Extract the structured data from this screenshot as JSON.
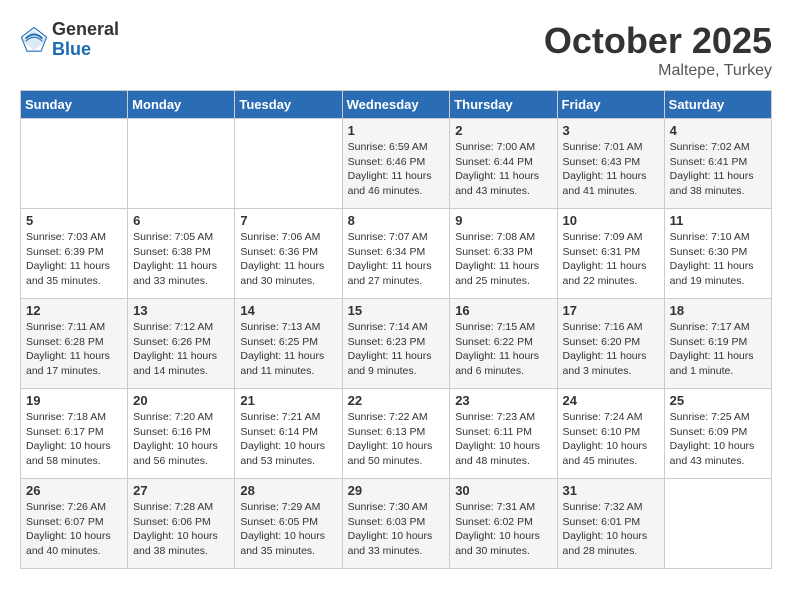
{
  "logo": {
    "general": "General",
    "blue": "Blue"
  },
  "title": "October 2025",
  "subtitle": "Maltepe, Turkey",
  "days_of_week": [
    "Sunday",
    "Monday",
    "Tuesday",
    "Wednesday",
    "Thursday",
    "Friday",
    "Saturday"
  ],
  "weeks": [
    [
      {
        "num": "",
        "info": ""
      },
      {
        "num": "",
        "info": ""
      },
      {
        "num": "",
        "info": ""
      },
      {
        "num": "1",
        "info": "Sunrise: 6:59 AM\nSunset: 6:46 PM\nDaylight: 11 hours\nand 46 minutes."
      },
      {
        "num": "2",
        "info": "Sunrise: 7:00 AM\nSunset: 6:44 PM\nDaylight: 11 hours\nand 43 minutes."
      },
      {
        "num": "3",
        "info": "Sunrise: 7:01 AM\nSunset: 6:43 PM\nDaylight: 11 hours\nand 41 minutes."
      },
      {
        "num": "4",
        "info": "Sunrise: 7:02 AM\nSunset: 6:41 PM\nDaylight: 11 hours\nand 38 minutes."
      }
    ],
    [
      {
        "num": "5",
        "info": "Sunrise: 7:03 AM\nSunset: 6:39 PM\nDaylight: 11 hours\nand 35 minutes."
      },
      {
        "num": "6",
        "info": "Sunrise: 7:05 AM\nSunset: 6:38 PM\nDaylight: 11 hours\nand 33 minutes."
      },
      {
        "num": "7",
        "info": "Sunrise: 7:06 AM\nSunset: 6:36 PM\nDaylight: 11 hours\nand 30 minutes."
      },
      {
        "num": "8",
        "info": "Sunrise: 7:07 AM\nSunset: 6:34 PM\nDaylight: 11 hours\nand 27 minutes."
      },
      {
        "num": "9",
        "info": "Sunrise: 7:08 AM\nSunset: 6:33 PM\nDaylight: 11 hours\nand 25 minutes."
      },
      {
        "num": "10",
        "info": "Sunrise: 7:09 AM\nSunset: 6:31 PM\nDaylight: 11 hours\nand 22 minutes."
      },
      {
        "num": "11",
        "info": "Sunrise: 7:10 AM\nSunset: 6:30 PM\nDaylight: 11 hours\nand 19 minutes."
      }
    ],
    [
      {
        "num": "12",
        "info": "Sunrise: 7:11 AM\nSunset: 6:28 PM\nDaylight: 11 hours\nand 17 minutes."
      },
      {
        "num": "13",
        "info": "Sunrise: 7:12 AM\nSunset: 6:26 PM\nDaylight: 11 hours\nand 14 minutes."
      },
      {
        "num": "14",
        "info": "Sunrise: 7:13 AM\nSunset: 6:25 PM\nDaylight: 11 hours\nand 11 minutes."
      },
      {
        "num": "15",
        "info": "Sunrise: 7:14 AM\nSunset: 6:23 PM\nDaylight: 11 hours\nand 9 minutes."
      },
      {
        "num": "16",
        "info": "Sunrise: 7:15 AM\nSunset: 6:22 PM\nDaylight: 11 hours\nand 6 minutes."
      },
      {
        "num": "17",
        "info": "Sunrise: 7:16 AM\nSunset: 6:20 PM\nDaylight: 11 hours\nand 3 minutes."
      },
      {
        "num": "18",
        "info": "Sunrise: 7:17 AM\nSunset: 6:19 PM\nDaylight: 11 hours\nand 1 minute."
      }
    ],
    [
      {
        "num": "19",
        "info": "Sunrise: 7:18 AM\nSunset: 6:17 PM\nDaylight: 10 hours\nand 58 minutes."
      },
      {
        "num": "20",
        "info": "Sunrise: 7:20 AM\nSunset: 6:16 PM\nDaylight: 10 hours\nand 56 minutes."
      },
      {
        "num": "21",
        "info": "Sunrise: 7:21 AM\nSunset: 6:14 PM\nDaylight: 10 hours\nand 53 minutes."
      },
      {
        "num": "22",
        "info": "Sunrise: 7:22 AM\nSunset: 6:13 PM\nDaylight: 10 hours\nand 50 minutes."
      },
      {
        "num": "23",
        "info": "Sunrise: 7:23 AM\nSunset: 6:11 PM\nDaylight: 10 hours\nand 48 minutes."
      },
      {
        "num": "24",
        "info": "Sunrise: 7:24 AM\nSunset: 6:10 PM\nDaylight: 10 hours\nand 45 minutes."
      },
      {
        "num": "25",
        "info": "Sunrise: 7:25 AM\nSunset: 6:09 PM\nDaylight: 10 hours\nand 43 minutes."
      }
    ],
    [
      {
        "num": "26",
        "info": "Sunrise: 7:26 AM\nSunset: 6:07 PM\nDaylight: 10 hours\nand 40 minutes."
      },
      {
        "num": "27",
        "info": "Sunrise: 7:28 AM\nSunset: 6:06 PM\nDaylight: 10 hours\nand 38 minutes."
      },
      {
        "num": "28",
        "info": "Sunrise: 7:29 AM\nSunset: 6:05 PM\nDaylight: 10 hours\nand 35 minutes."
      },
      {
        "num": "29",
        "info": "Sunrise: 7:30 AM\nSunset: 6:03 PM\nDaylight: 10 hours\nand 33 minutes."
      },
      {
        "num": "30",
        "info": "Sunrise: 7:31 AM\nSunset: 6:02 PM\nDaylight: 10 hours\nand 30 minutes."
      },
      {
        "num": "31",
        "info": "Sunrise: 7:32 AM\nSunset: 6:01 PM\nDaylight: 10 hours\nand 28 minutes."
      },
      {
        "num": "",
        "info": ""
      }
    ]
  ]
}
